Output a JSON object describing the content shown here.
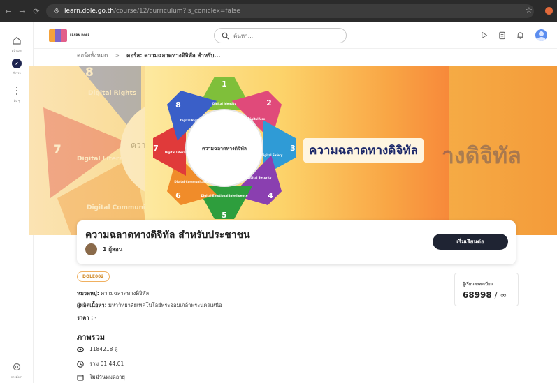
{
  "browser": {
    "url_host": "learn.dole.go.th",
    "url_path": "/course/12/curriculum?is_coniclex=false"
  },
  "rail": {
    "items": [
      {
        "label": "หน้าแรก"
      },
      {
        "label": "สำรวจ"
      },
      {
        "label": "อื่น ๆ"
      },
      {
        "label": "การตั้งค่า"
      }
    ]
  },
  "header": {
    "logo_text": "LEARN DOLE",
    "search_placeholder": "ค้นหา..."
  },
  "breadcrumb": {
    "root": "คอร์สทั้งหมด",
    "separator": ">",
    "current": "คอร์ส: ความฉลาดทางดิจิทัล สำหรับ..."
  },
  "banner": {
    "title": "ความฉลาดทางดิจิทัล",
    "ghost_text": "างดิจิทัล",
    "wheel_center": "ความฉลาดทางดิจิทัล",
    "wheel_segments": [
      {
        "number": "1",
        "label": "Digital Identity",
        "color": "#7fbf3a"
      },
      {
        "number": "2",
        "label": "Digital Use",
        "color": "#e04a7a"
      },
      {
        "number": "3",
        "label": "Digital Safety",
        "color": "#2f9bd6"
      },
      {
        "number": "4",
        "label": "Digital Security",
        "color": "#8a3fb0"
      },
      {
        "number": "5",
        "label": "Digital Emotional Intelligence",
        "color": "#2e9e3d"
      },
      {
        "number": "6",
        "label": "Digital Communication",
        "color": "#f08c2a"
      },
      {
        "number": "7",
        "label": "Digital Literacy",
        "color": "#e03a3a"
      },
      {
        "number": "8",
        "label": "Digital Rights",
        "color": "#3a5fc8"
      }
    ],
    "blur_labels": [
      "Digital Rights",
      "Digital Literacy",
      "Digital Communication",
      "ความ"
    ],
    "blur_numbers": [
      "8",
      "7"
    ]
  },
  "course": {
    "title": "ความฉลาดทางดิจิทัล สำหรับประชาชน",
    "instructor": "1 ผู้สอน",
    "start_button": "เริ่มเรียนต่อ"
  },
  "details": {
    "code": "DOLE002",
    "category_label": "หมวดหมู่:",
    "category_value": "ความฉลาดทางดิจิทัล",
    "producer_label": "ผู้ผลิตเนื้อหา:",
    "producer_value": "มหาวิทยาลัยเทคโนโลยีพระจอมเกล้าพระนครเหนือ",
    "price_label": "ราคา :",
    "price_value": "-",
    "overview_title": "ภาพรวม",
    "views": "1184218 ดู",
    "duration": "รวม 01:44:01",
    "expiry": "ไม่มีวันหมดอายุ"
  },
  "enroll": {
    "label": "ผู้เรียนลงทะเบียน",
    "count": "68998",
    "separator": " / ",
    "limit": "∞"
  }
}
